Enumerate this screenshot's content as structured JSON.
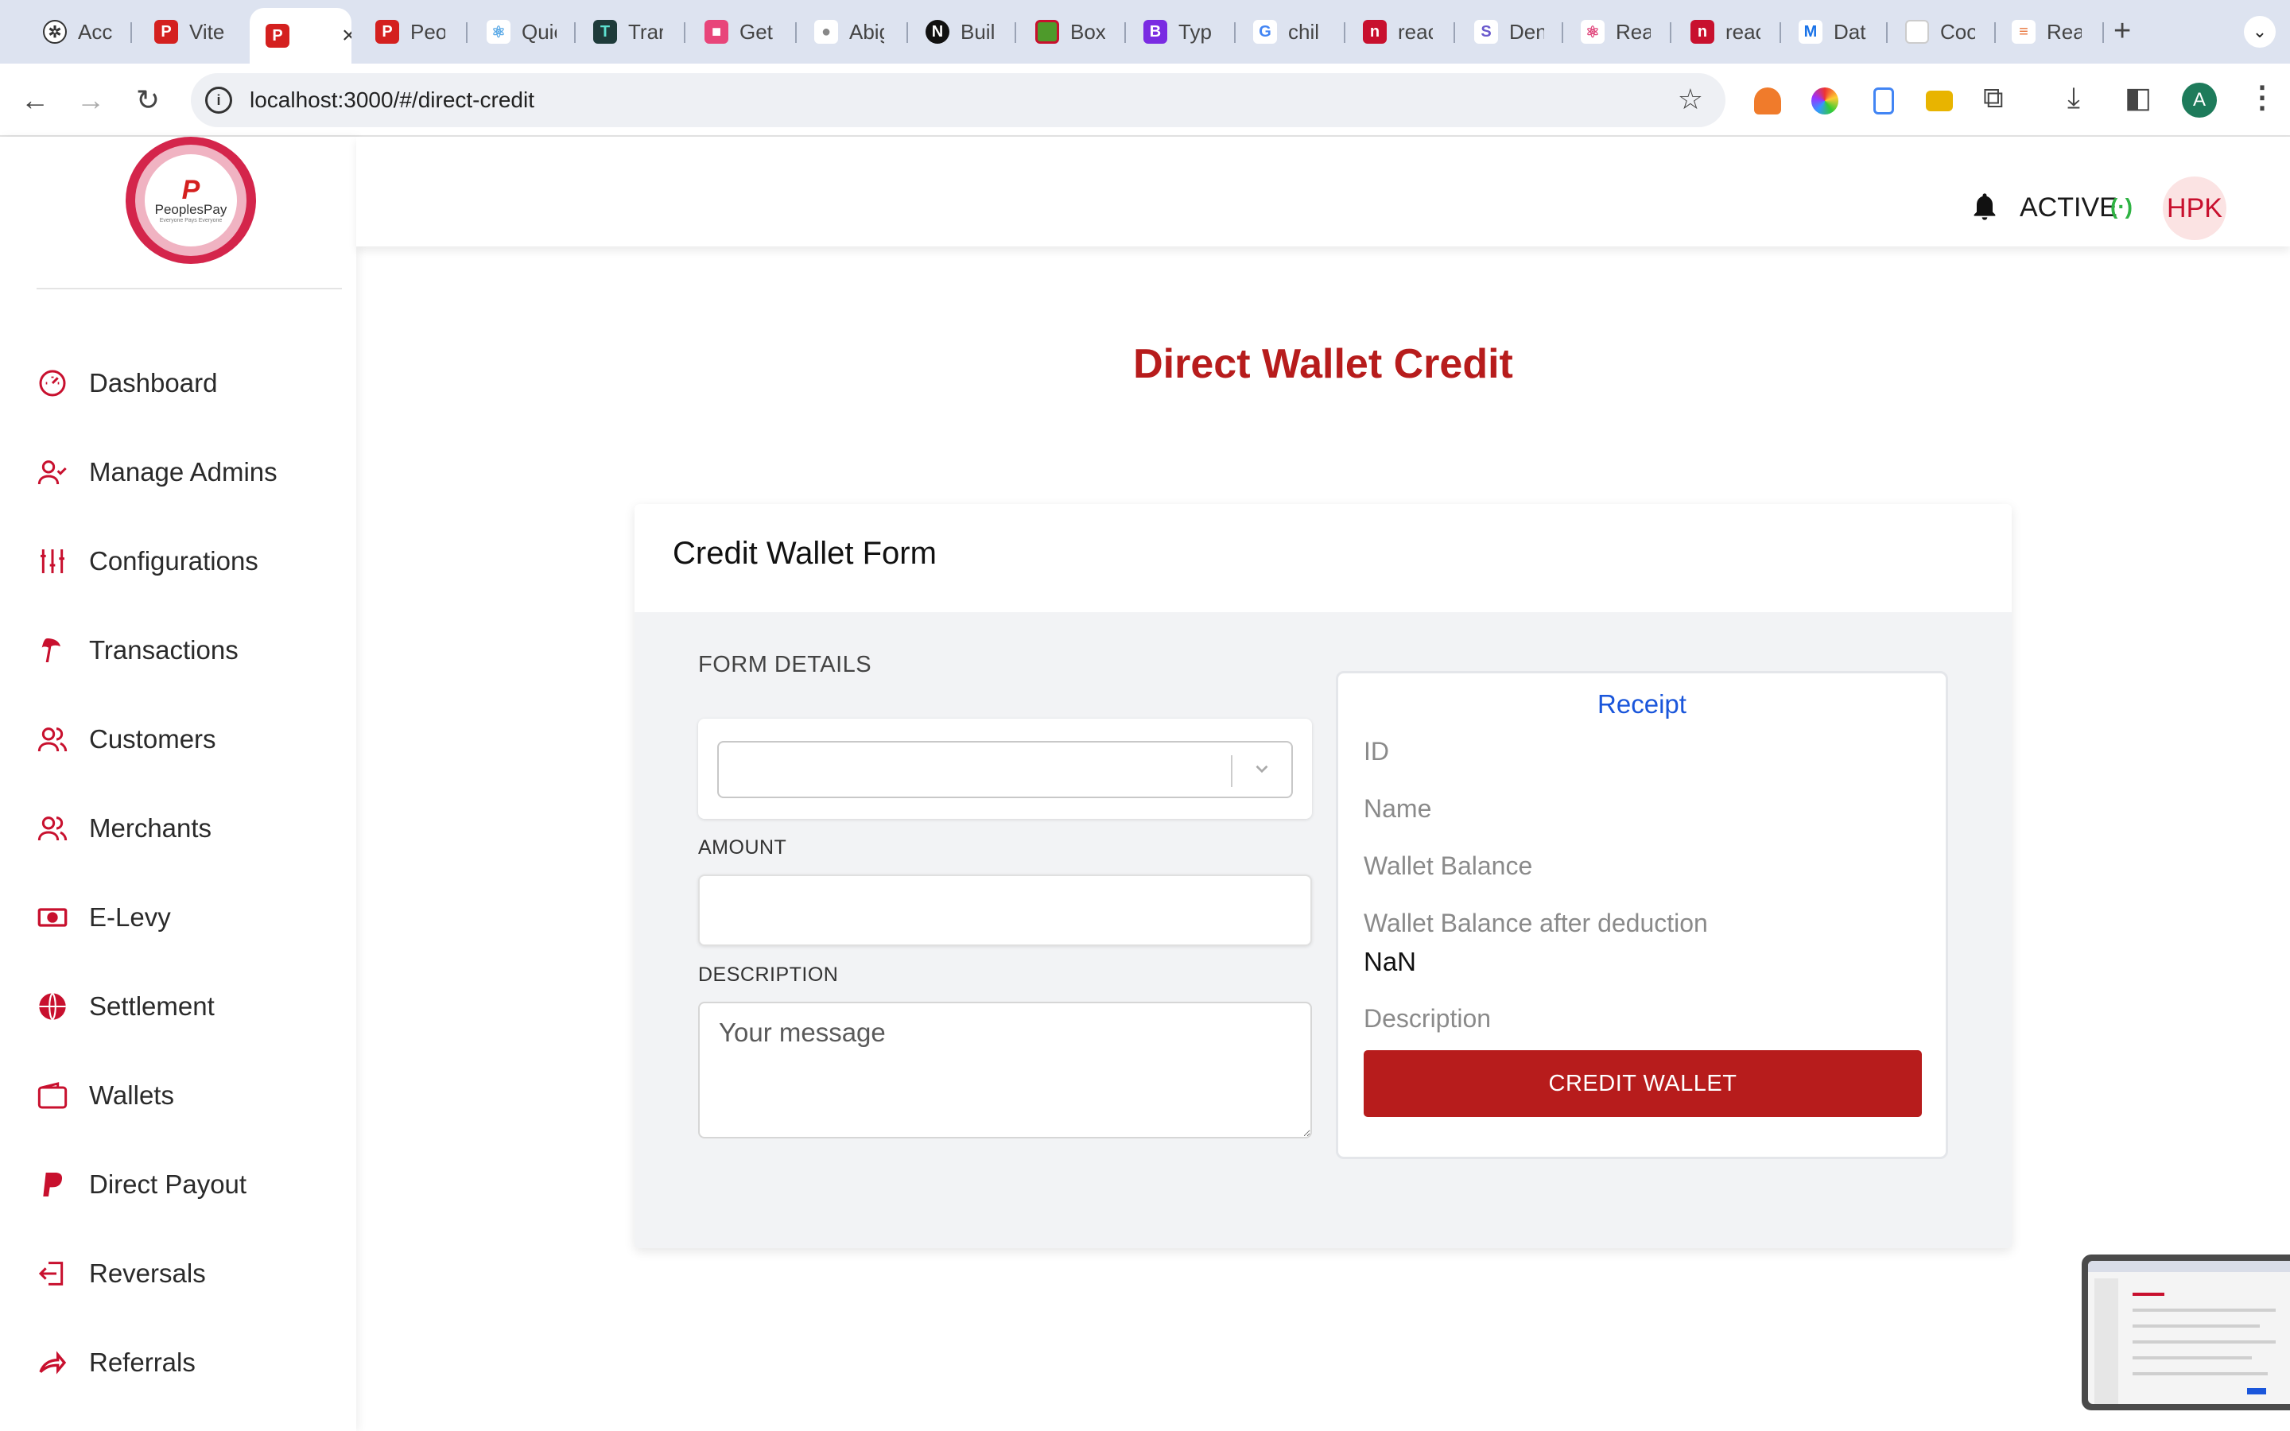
{
  "browser": {
    "tabs": [
      {
        "title": "Acc",
        "icon": "openai-icon",
        "color": "#333333"
      },
      {
        "title": "Vite",
        "icon": "peoplespay-icon",
        "color": "#d4201f"
      },
      {
        "title": "",
        "icon": "peoplespay-icon",
        "color": "#d4201f",
        "active": true
      },
      {
        "title": "Peo",
        "icon": "peoplespay-icon",
        "color": "#d4201f"
      },
      {
        "title": "Quic",
        "icon": "react-icon",
        "color": "#5aa9e6"
      },
      {
        "title": "Trar",
        "icon": "tailwind-icon",
        "color": "#2b7a78"
      },
      {
        "title": "Get",
        "icon": "app-icon",
        "color": "#e8457a"
      },
      {
        "title": "Abig",
        "icon": "github-icon",
        "color": "#888888"
      },
      {
        "title": "Buil",
        "icon": "nextjs-icon",
        "color": "#111111"
      },
      {
        "title": "Box",
        "icon": "box-icon",
        "color": "#4e9a2b"
      },
      {
        "title": "Typ",
        "icon": "bootstrap-icon",
        "color": "#7a2be2"
      },
      {
        "title": "chil",
        "icon": "google-icon",
        "color": "#4285f4"
      },
      {
        "title": "reac",
        "icon": "npm-icon",
        "color": "#c8102e"
      },
      {
        "title": "Den",
        "icon": "stripe-icon",
        "color": "#6a5acd"
      },
      {
        "title": "Rea",
        "icon": "react-icon",
        "color": "#e0457b"
      },
      {
        "title": "reac",
        "icon": "npm-icon",
        "color": "#c8102e"
      },
      {
        "title": "Dat",
        "icon": "mui-icon",
        "color": "#1a73e8"
      },
      {
        "title": "Coo",
        "icon": "blank-page-icon",
        "color": "#dddddd"
      },
      {
        "title": "Rea",
        "icon": "layers-icon",
        "color": "#e8743b"
      }
    ],
    "url": "localhost:3000/#/direct-credit",
    "profile_initial": "A"
  },
  "sidebar": {
    "logo": {
      "mark": "P",
      "brand": "PeoplesPay",
      "tagline": "Everyone Pays Everyone"
    },
    "items": [
      {
        "label": "Dashboard",
        "icon": "speedometer-icon"
      },
      {
        "label": "Manage Admins",
        "icon": "user-check-icon"
      },
      {
        "label": "Configurations",
        "icon": "sliders-icon"
      },
      {
        "label": "Transactions",
        "icon": "tree-icon"
      },
      {
        "label": "Customers",
        "icon": "users-icon"
      },
      {
        "label": "Merchants",
        "icon": "users-icon"
      },
      {
        "label": "E-Levy",
        "icon": "money-icon"
      },
      {
        "label": "Settlement",
        "icon": "globe-icon"
      },
      {
        "label": "Wallets",
        "icon": "wallet-icon"
      },
      {
        "label": "Direct Payout",
        "icon": "paypal-icon"
      },
      {
        "label": "Reversals",
        "icon": "sign-in-icon"
      },
      {
        "label": "Referrals",
        "icon": "share-icon"
      }
    ]
  },
  "header": {
    "status": "ACTIVE",
    "status_signal": "(·)",
    "avatar_initials": "HPK"
  },
  "main": {
    "page_title": "Direct Wallet Credit",
    "card_title": "Credit Wallet Form",
    "section_label": "FORM DETAILS",
    "select_value": "",
    "amount_label": "AMOUNT",
    "amount_value": "",
    "description_label": "DESCRIPTION",
    "description_placeholder": "Your message",
    "receipt": {
      "title": "Receipt",
      "id_label": "ID",
      "name_label": "Name",
      "balance_label": "Wallet Balance",
      "after_label": "Wallet Balance after deduction",
      "after_value": "NaN",
      "description_label": "Description",
      "button_label": "CREDIT WALLET"
    }
  },
  "colors": {
    "brand_red": "#b71c1c",
    "receipt_blue": "#1a56db",
    "status_green": "#2fb344"
  }
}
